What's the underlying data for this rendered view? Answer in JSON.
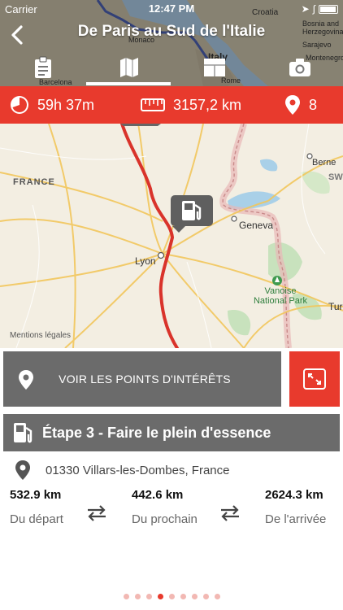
{
  "status": {
    "carrier": "Carrier",
    "time": "12:47 PM"
  },
  "header": {
    "title": "De Paris au Sud de l'Italie",
    "map_labels": [
      "Croatia",
      "Bosnia and Herzegovina",
      "Sarajevo",
      "Montenegro",
      "Monaco",
      "Italy",
      "Barcelona",
      "Rome"
    ],
    "tabs": [
      {
        "icon": "clipboard-icon",
        "active": false
      },
      {
        "icon": "map-icon",
        "active": true
      },
      {
        "icon": "layout-icon",
        "active": false
      },
      {
        "icon": "camera-icon",
        "active": false
      }
    ]
  },
  "stats": {
    "duration": "59h 37m",
    "distance": "3157,2 km",
    "stops": "8"
  },
  "map": {
    "labels": {
      "france": "FRANCE",
      "lyon": "Lyon",
      "geneva": "Geneva",
      "berne": "Berne",
      "vanoise": "Vanoise National Park",
      "turin": "Tur",
      "sw": "SW"
    },
    "mentions": "Mentions légales"
  },
  "poi_button": {
    "label": "VOIR LES POINTS D'INTÉRÊTS"
  },
  "step": {
    "title": "Étape 3 - Faire le plein d'essence",
    "address": "01330 Villars-les-Dombes, France",
    "from_start": {
      "value": "532.9 km",
      "label": "Du départ"
    },
    "to_next": {
      "value": "442.6 km",
      "label": "Du prochain"
    },
    "to_end": {
      "value": "2624.3 km",
      "label": "De l'arrivée"
    }
  },
  "pagination": {
    "total": 9,
    "current": 4
  },
  "colors": {
    "accent": "#e83a2d",
    "dark_gray": "#6b6b6b",
    "route": "#d9332b"
  }
}
